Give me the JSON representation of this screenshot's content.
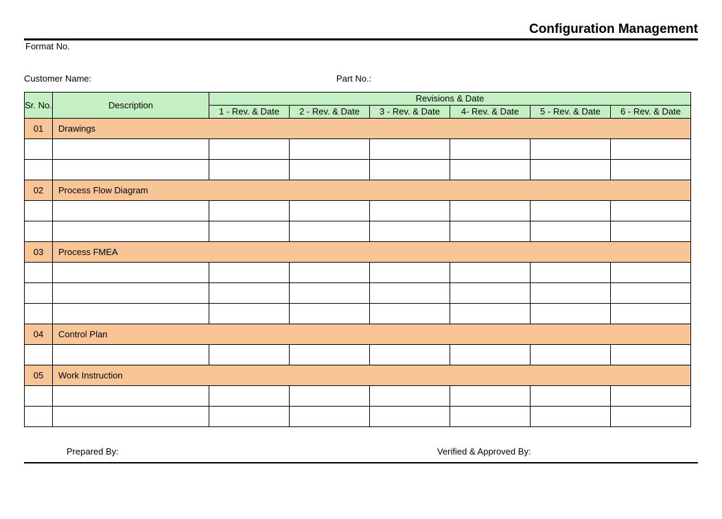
{
  "title": "Configuration Management",
  "format_no_label": "Format No.",
  "customer_name_label": "Customer Name:",
  "part_no_label": "Part No.:",
  "headers": {
    "sr_no": "Sr. No.",
    "description": "Description",
    "revisions_date": "Revisions & Date",
    "rev_cols": [
      "1 - Rev. & Date",
      "2 - Rev. & Date",
      "3 - Rev. & Date",
      "4- Rev. & Date",
      "5 - Rev. & Date",
      "6 - Rev. & Date"
    ]
  },
  "sections": [
    {
      "no": "01",
      "title": "Drawings",
      "blank_rows": 2
    },
    {
      "no": "02",
      "title": "Process Flow Diagram",
      "blank_rows": 2
    },
    {
      "no": "03",
      "title": "Process FMEA",
      "blank_rows": 3
    },
    {
      "no": "04",
      "title": "Control Plan",
      "blank_rows": 1
    },
    {
      "no": "05",
      "title": "Work Instruction",
      "blank_rows": 2
    }
  ],
  "footer": {
    "prepared_by": "Prepared By:",
    "verified_by": "Verified & Approved By:"
  }
}
